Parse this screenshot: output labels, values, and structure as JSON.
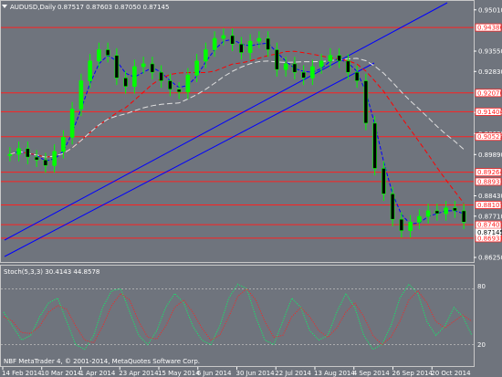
{
  "header": {
    "symbol_info": "AUDUSD,Daily",
    "ohlc": "0.87517 0.87603 0.87050 0.87145"
  },
  "stoch": {
    "label": "Stoch(5,3,3) 30.4143 44.8578",
    "levels": [
      "80",
      "20"
    ]
  },
  "copyright": "NBF MetaTrader 4, © 2001-2014, MetaQuotes Software Corp.",
  "colors": {
    "background": "#6f747d",
    "bull_candle": "#00ff00",
    "hline": "#ff2020",
    "trendline": "#0000ff",
    "ma_fast": "#0000ff",
    "ma_slow": "#ff0000",
    "ma_long": "#e0e0e0",
    "stoch_main": "#00ff66",
    "stoch_signal": "#ff2020"
  },
  "price_axis": {
    "ticks": [
      "0.95010",
      "0.93550",
      "0.92830",
      "0.91380",
      "0.90630",
      "0.89890",
      "0.88430",
      "0.87710",
      "0.86250"
    ],
    "badges_red": [
      "0.94386",
      "0.92070",
      "0.91404",
      "0.90523",
      "0.89264",
      "0.88933",
      "0.88107",
      "0.87407",
      "0.86931"
    ],
    "current_price": "0.87145"
  },
  "time_axis": [
    "14 Feb 2014",
    "10 Mar 2014",
    "1 Apr 2014",
    "23 Apr 2014",
    "15 May 2014",
    "6 Jun 2014",
    "30 Jun 2014",
    "22 Jul 2014",
    "13 Aug 2014",
    "4 Sep 2014",
    "26 Sep 2014",
    "20 Oct 2014"
  ],
  "chart_data": {
    "type": "candlestick",
    "title": "AUDUSD,Daily",
    "ylim": [
      0.8625,
      0.951
    ],
    "x": [
      "14 Feb 2014",
      "10 Mar 2014",
      "1 Apr 2014",
      "23 Apr 2014",
      "15 May 2014",
      "6 Jun 2014",
      "30 Jun 2014",
      "22 Jul 2014",
      "13 Aug 2014",
      "4 Sep 2014",
      "26 Sep 2014",
      "20 Oct 2014"
    ],
    "close_series": [
      0.899,
      0.901,
      0.898,
      0.897,
      0.895,
      0.9,
      0.905,
      0.915,
      0.925,
      0.932,
      0.936,
      0.934,
      0.926,
      0.923,
      0.93,
      0.931,
      0.928,
      0.925,
      0.922,
      0.921,
      0.927,
      0.932,
      0.936,
      0.94,
      0.941,
      0.938,
      0.935,
      0.939,
      0.94,
      0.936,
      0.929,
      0.931,
      0.928,
      0.926,
      0.93,
      0.932,
      0.934,
      0.932,
      0.928,
      0.925,
      0.91,
      0.894,
      0.885,
      0.876,
      0.872,
      0.875,
      0.877,
      0.879,
      0.878,
      0.88,
      0.879,
      0.875
    ],
    "horizontal_levels": [
      0.94386,
      0.9207,
      0.91404,
      0.90523,
      0.89264,
      0.88933,
      0.88107,
      0.87407,
      0.86931
    ],
    "stoch_levels": [
      80,
      20
    ],
    "stoch_main": [
      55,
      40,
      25,
      30,
      50,
      65,
      70,
      45,
      20,
      15,
      30,
      60,
      78,
      80,
      55,
      30,
      20,
      35,
      60,
      75,
      65,
      40,
      25,
      20,
      40,
      70,
      85,
      80,
      50,
      25,
      20,
      45,
      70,
      60,
      35,
      25,
      30,
      55,
      75,
      60,
      30,
      15,
      20,
      40,
      70,
      85,
      75,
      45,
      30,
      40,
      60,
      50,
      30
    ],
    "stoch_signal": [
      50,
      45,
      33,
      32,
      40,
      55,
      62,
      58,
      40,
      25,
      22,
      40,
      62,
      75,
      68,
      45,
      28,
      26,
      40,
      60,
      68,
      55,
      38,
      25,
      30,
      50,
      72,
      80,
      68,
      45,
      28,
      30,
      50,
      60,
      50,
      35,
      28,
      38,
      55,
      65,
      50,
      30,
      20,
      28,
      45,
      68,
      78,
      65,
      45,
      38,
      45,
      52,
      45
    ]
  }
}
